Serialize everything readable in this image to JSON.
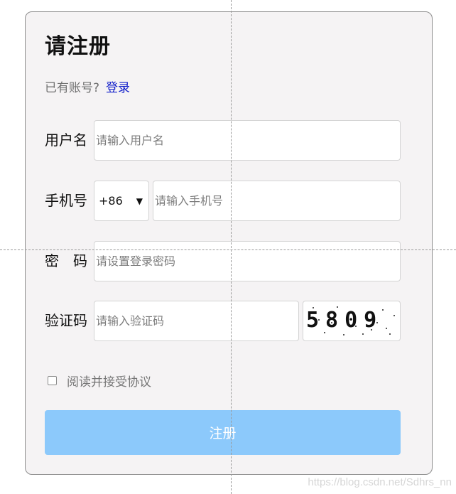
{
  "form": {
    "title": "请注册",
    "login_prompt": "已有账号?",
    "login_link": "登录",
    "username": {
      "label": "用户名",
      "placeholder": "请输入用户名",
      "value": ""
    },
    "phone": {
      "label": "手机号",
      "country_code": "+86",
      "placeholder": "请输入手机号",
      "value": ""
    },
    "password": {
      "label": "密　码",
      "placeholder": "请设置登录密码",
      "value": ""
    },
    "captcha": {
      "label": "验证码",
      "placeholder": "请输入验证码",
      "value": "",
      "image_text": "5809"
    },
    "agreement_label": "阅读并接受协议",
    "agreement_checked": false,
    "submit_label": "注册"
  },
  "watermark": "https://blog.csdn.net/Sdhrs_nn",
  "colors": {
    "panel_bg": "#f5f3f4",
    "panel_border": "#8d8d8d",
    "link": "#0f1cc9",
    "button_bg": "#8cc9fb",
    "button_text": "#ffffff"
  },
  "icons": {
    "dropdown": "triangle-down"
  }
}
